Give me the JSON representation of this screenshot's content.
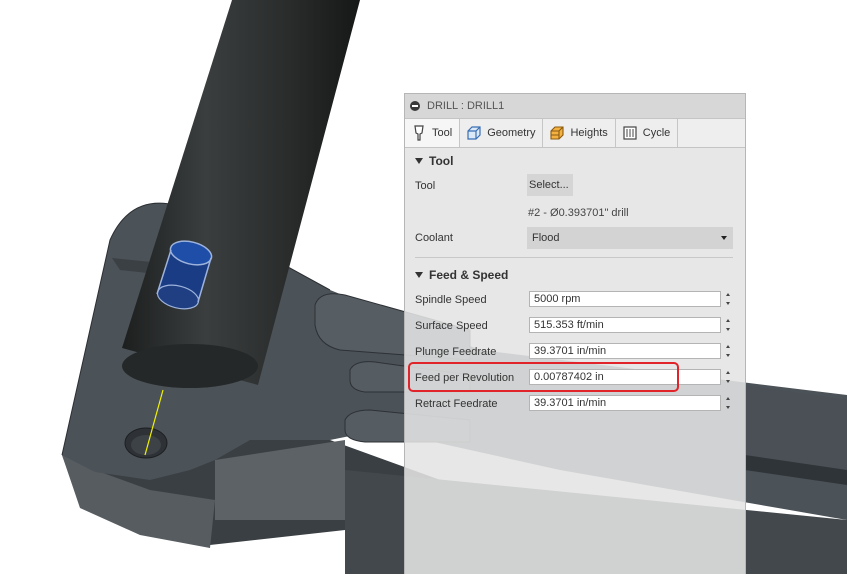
{
  "dialog": {
    "title": "DRILL : DRILL1",
    "tabs": [
      {
        "label": "Tool",
        "icon": "tool-icon",
        "active": true
      },
      {
        "label": "Geometry",
        "icon": "geometry-icon",
        "active": false
      },
      {
        "label": "Heights",
        "icon": "heights-icon",
        "active": false
      },
      {
        "label": "Cycle",
        "icon": "cycle-icon",
        "active": false
      }
    ],
    "tool_section": {
      "heading": "Tool",
      "tool_label": "Tool",
      "select_button": "Select...",
      "tool_description": "#2 - Ø0.393701\" drill",
      "coolant_label": "Coolant",
      "coolant_value": "Flood"
    },
    "feed_section": {
      "heading": "Feed & Speed",
      "fields": [
        {
          "label": "Spindle Speed",
          "value": "5000 rpm"
        },
        {
          "label": "Surface Speed",
          "value": "515.353 ft/min"
        },
        {
          "label": "Plunge Feedrate",
          "value": "39.3701 in/min"
        },
        {
          "label": "Feed per Revolution",
          "value": "0.00787402 in",
          "highlighted": true
        },
        {
          "label": "Retract Feedrate",
          "value": "39.3701 in/min"
        }
      ]
    }
  },
  "colors": {
    "highlight": "#e0242a",
    "part_body": "#4b5258",
    "tool_body": "#2a2d2d",
    "drill_blue": "#1f4ea8",
    "toolpath": "#f2f200"
  }
}
